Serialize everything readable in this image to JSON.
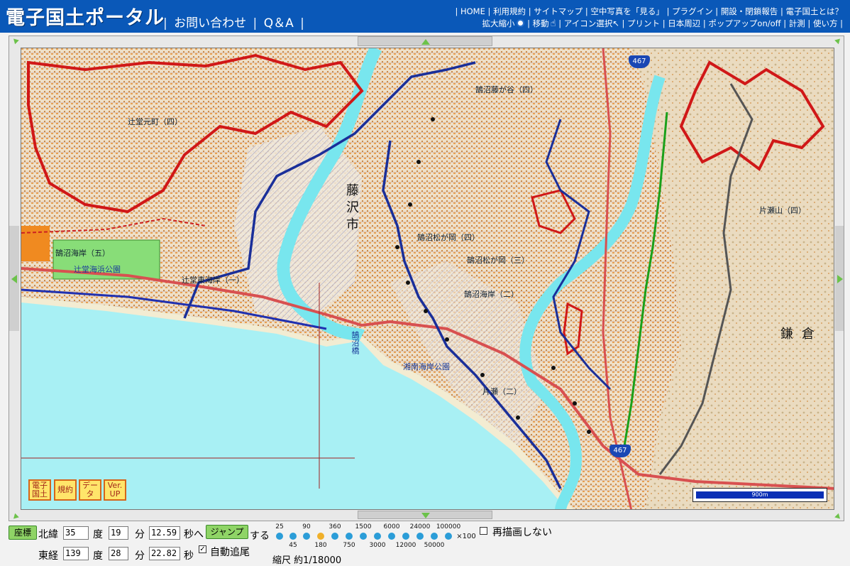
{
  "header": {
    "logo": "電子国土ポータル",
    "nav_main": [
      "お問い合わせ",
      "Q＆A"
    ],
    "top_links_row1": [
      "HOME",
      "利用規約",
      "サイトマップ",
      "空中写真を「見る」",
      "プラグイン",
      "開設・閉鎖報告",
      "電子国土とは？"
    ],
    "top_links_row2": [
      "拡大縮小",
      "移動",
      "アイコン選択",
      "プリント",
      "日本周辺",
      "ポップアップon/off",
      "計測",
      "使い方"
    ]
  },
  "map": {
    "labels": {
      "city_fujisawa": "藤沢市",
      "kamakura": "鎌倉",
      "park": "辻堂海浜公園",
      "beach": "湘南海岸公園",
      "bridge": "鵠沼橋",
      "route1": "467",
      "route2": "467",
      "area1": "鵠沼海岸（五）",
      "area2": "鵠沼松が岡（四）",
      "area3": "片瀬（二）",
      "area4": "鵠沼松が岡（三）",
      "area5": "辻堂元町（四）",
      "area6": "鵠沼藤が谷（四）",
      "area7": "片瀬山（四）",
      "area8": "鵠沼海岸（二）",
      "area9": "辻堂東海岸（一）"
    },
    "scale_label": "900m",
    "corner_buttons": [
      "電子国土",
      "規約",
      "データ",
      "Ver. UP"
    ]
  },
  "controls": {
    "coord_button": "座標",
    "lat_label": "北緯",
    "lat_deg": "35",
    "lat_min": "19",
    "lat_sec": "12.59",
    "lon_label": "東経",
    "lon_deg": "139",
    "lon_min": "28",
    "lon_sec": "22.82",
    "deg_unit": "度",
    "min_unit": "分",
    "sec_unit_lat": "秒へ",
    "sec_unit_lon": "秒",
    "jump_button": "ジャンプ",
    "jump_suffix": "する",
    "auto_follow_label": "自動追尾",
    "auto_follow_checked": true,
    "no_redraw_label": "再描画しない",
    "no_redraw_checked": false,
    "zoom_top": [
      "25",
      "90",
      "360",
      "1500",
      "6000",
      "24000",
      "100000"
    ],
    "zoom_bottom": [
      "45",
      "180",
      "750",
      "3000",
      "12000",
      "50000"
    ],
    "zoom_suffix": "×100",
    "zoom_selected": "180",
    "scale_text": "縮尺 約1/18000"
  },
  "colors": {
    "header_bg": "#0a58b8",
    "sea": "#a8f0f4",
    "river": "#78e6ee",
    "boundary_blue": "#1a2f9a",
    "boundary_red": "#d01818",
    "park_green": "#88dd78",
    "zoom_dot": "#2b9dd8",
    "zoom_selected_dot": "#f0b02a"
  }
}
